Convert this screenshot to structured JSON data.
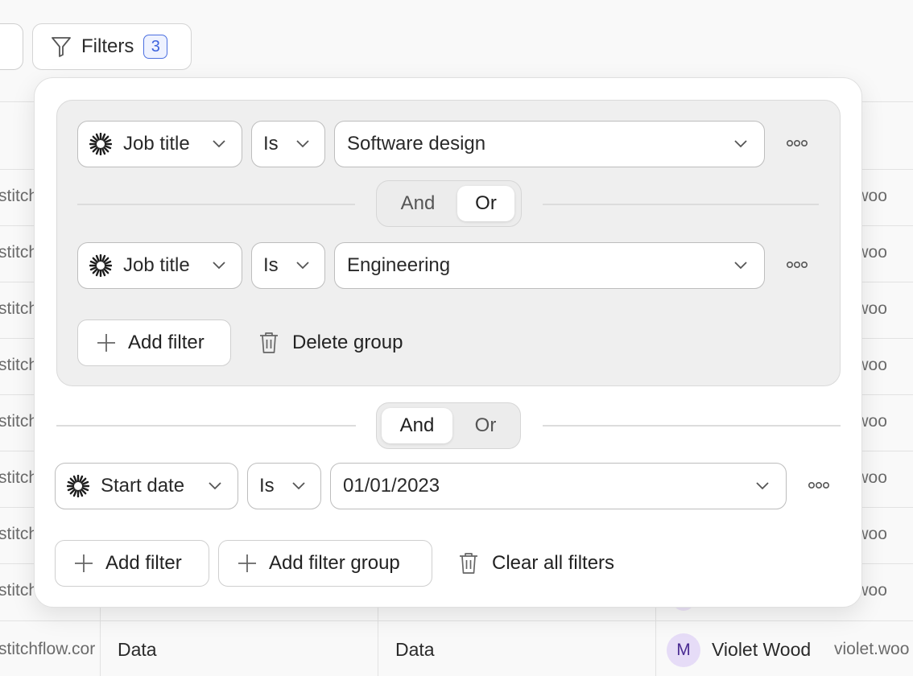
{
  "toolbar": {
    "filters_label": "Filters",
    "filters_count": "3"
  },
  "background_table": {
    "left_column_fragment": "stitch",
    "right_column_fragment": "et.woo",
    "last_row": {
      "email_left": "stitchflow.cor",
      "col2": "Data",
      "col3": "Data",
      "avatar_initial": "M",
      "name": "Violet Wood",
      "email_right": "violet.woo"
    }
  },
  "group": {
    "filters": [
      {
        "field": "Job title",
        "operator": "Is",
        "value": "Software design"
      },
      {
        "field": "Job title",
        "operator": "Is",
        "value": "Engineering"
      }
    ],
    "conjunction": {
      "options": [
        "And",
        "Or"
      ],
      "selected": "Or"
    },
    "add_filter_label": "Add filter",
    "delete_group_label": "Delete group"
  },
  "root": {
    "conjunction": {
      "options": [
        "And",
        "Or"
      ],
      "selected": "And"
    },
    "filter": {
      "field": "Start date",
      "operator": "Is",
      "value": "01/01/2023"
    },
    "add_filter_label": "Add filter",
    "add_filter_group_label": "Add filter group",
    "clear_all_label": "Clear all filters"
  },
  "icons": {
    "filter": "funnel-icon",
    "field": "sparkle-icon",
    "dropdown": "chevron-down-icon",
    "more": "more-options-icon",
    "add": "plus-icon",
    "delete": "trash-icon"
  },
  "colors": {
    "badge_accent": "#3e63dd",
    "avatar_bg": "#e6dcf7",
    "avatar_fg": "#4b2c93"
  }
}
